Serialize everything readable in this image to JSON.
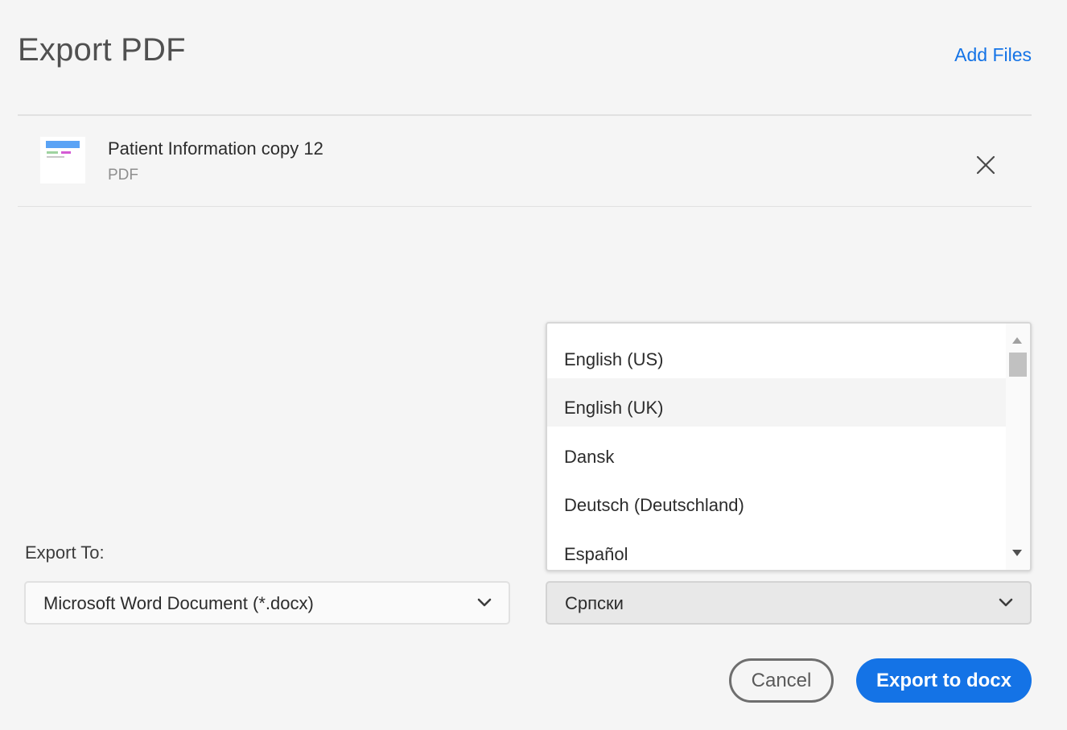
{
  "dialog": {
    "title": "Export PDF",
    "add_files_label": "Add Files"
  },
  "file": {
    "name": "Patient Information copy 12",
    "type": "PDF"
  },
  "export": {
    "label": "Export To:",
    "format_value": "Microsoft Word Document (*.docx)",
    "language_value": "Српски"
  },
  "language_options": [
    "English (US)",
    "English (UK)",
    "Dansk",
    "Deutsch (Deutschland)",
    "Español"
  ],
  "buttons": {
    "cancel_label": "Cancel",
    "export_label": "Export to docx"
  },
  "colors": {
    "accent": "#1473e6",
    "background": "#f5f5f5"
  },
  "icons": [
    "file-thumbnail",
    "close-icon",
    "chevron-down-icon",
    "scroll-up-arrow",
    "scroll-down-arrow"
  ]
}
